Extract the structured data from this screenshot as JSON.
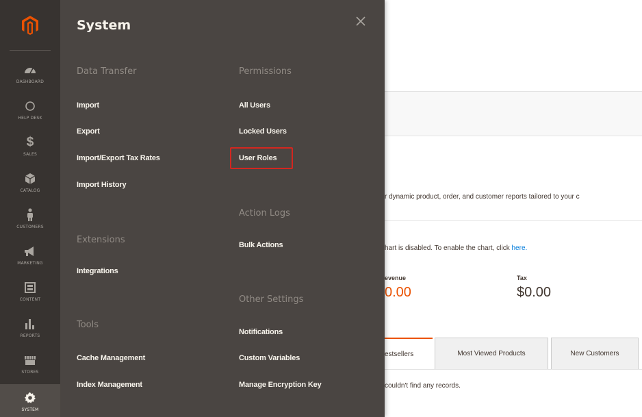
{
  "nav": {
    "items": [
      {
        "label": "Dashboard",
        "icon": "dashboard-icon"
      },
      {
        "label": "Help Desk",
        "icon": "help-desk-icon"
      },
      {
        "label": "Sales",
        "icon": "dollar-icon"
      },
      {
        "label": "Catalog",
        "icon": "cube-icon"
      },
      {
        "label": "Customers",
        "icon": "person-icon"
      },
      {
        "label": "Marketing",
        "icon": "megaphone-icon"
      },
      {
        "label": "Content",
        "icon": "layout-icon"
      },
      {
        "label": "Reports",
        "icon": "bar-chart-icon"
      },
      {
        "label": "Stores",
        "icon": "store-icon"
      },
      {
        "label": "System",
        "icon": "gear-icon",
        "active": true
      }
    ]
  },
  "flyout": {
    "title": "System",
    "columns": {
      "left": [
        {
          "title": "Data Transfer",
          "links": [
            "Import",
            "Export",
            "Import/Export Tax Rates",
            "Import History"
          ]
        },
        {
          "title": "Extensions",
          "links": [
            "Integrations"
          ]
        },
        {
          "title": "Tools",
          "links": [
            "Cache Management",
            "Index Management"
          ]
        }
      ],
      "right": [
        {
          "title": "Permissions",
          "links": [
            "All Users",
            "Locked Users",
            "User Roles"
          ]
        },
        {
          "title": "Action Logs",
          "links": [
            "Bulk Actions"
          ]
        },
        {
          "title": "Other Settings",
          "links": [
            "Notifications",
            "Custom Variables",
            "Manage Encryption Key"
          ]
        }
      ]
    },
    "highlighted_link": "User Roles"
  },
  "dashboard": {
    "reports_text": "r dynamic product, order, and customer reports tailored to your c",
    "chart_text": "hart is disabled. To enable the chart, click ",
    "chart_link": "here.",
    "stats": [
      {
        "label": "evenue",
        "value": "0.00"
      },
      {
        "label": "Tax",
        "value": "$0.00"
      }
    ],
    "tabs": [
      "estsellers",
      "Most Viewed Products",
      "New Customers"
    ],
    "empty_text": "couldn't find any records."
  },
  "colors": {
    "nav_bg": "#373330",
    "flyout_bg": "#4a4542",
    "logo_orange": "#eb5202",
    "highlight_red": "#d4261f"
  }
}
